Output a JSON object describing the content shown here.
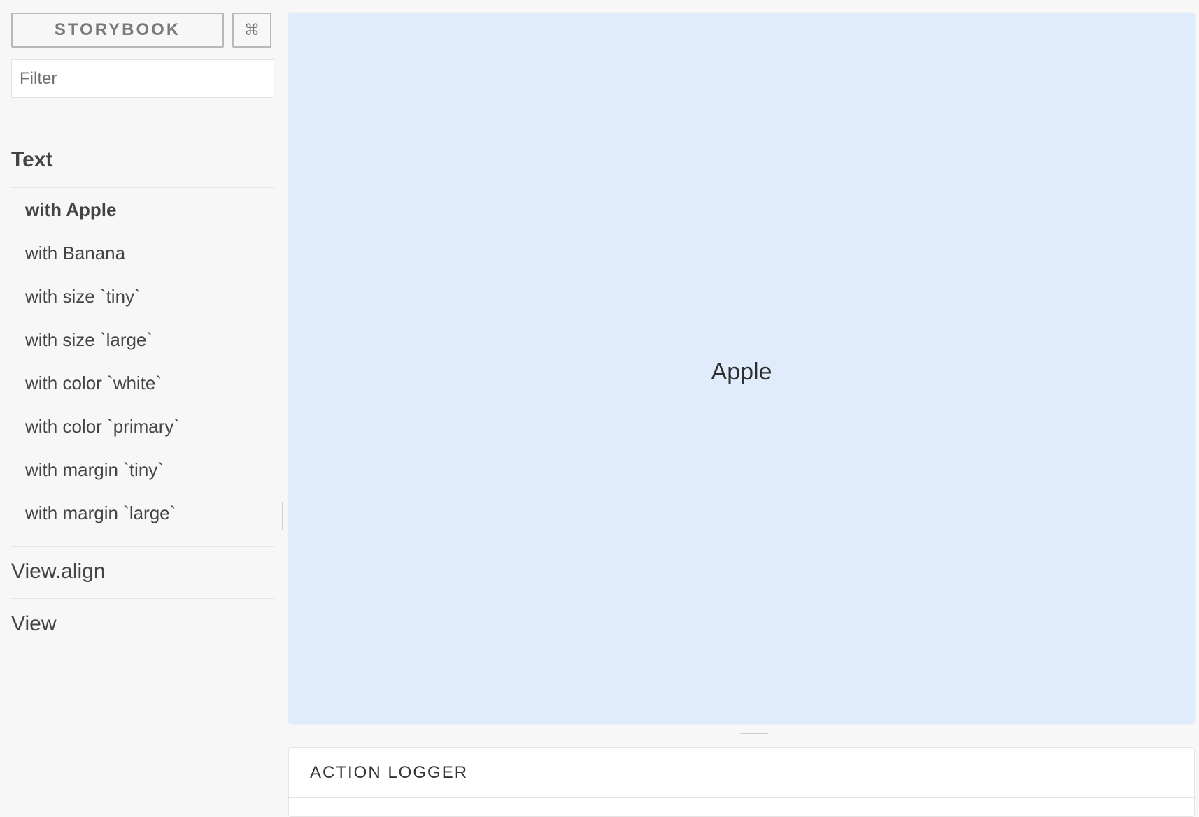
{
  "header": {
    "brand_label": "STORYBOOK",
    "shortcuts_label": "⌘"
  },
  "filter": {
    "placeholder": "Filter",
    "value": ""
  },
  "kinds": [
    {
      "title": "Text",
      "stories": [
        "with Apple",
        "with Banana",
        "with size `tiny`",
        "with size `large`",
        "with color `white`",
        "with color `primary`",
        "with margin `tiny`",
        "with margin `large`"
      ],
      "selected_story": "with Apple"
    },
    {
      "title": "View.align"
    },
    {
      "title": "View"
    }
  ],
  "preview": {
    "text": "Apple",
    "background": "#e0ecfc"
  },
  "addon_panel": {
    "tabs": [
      "ACTION LOGGER"
    ]
  }
}
